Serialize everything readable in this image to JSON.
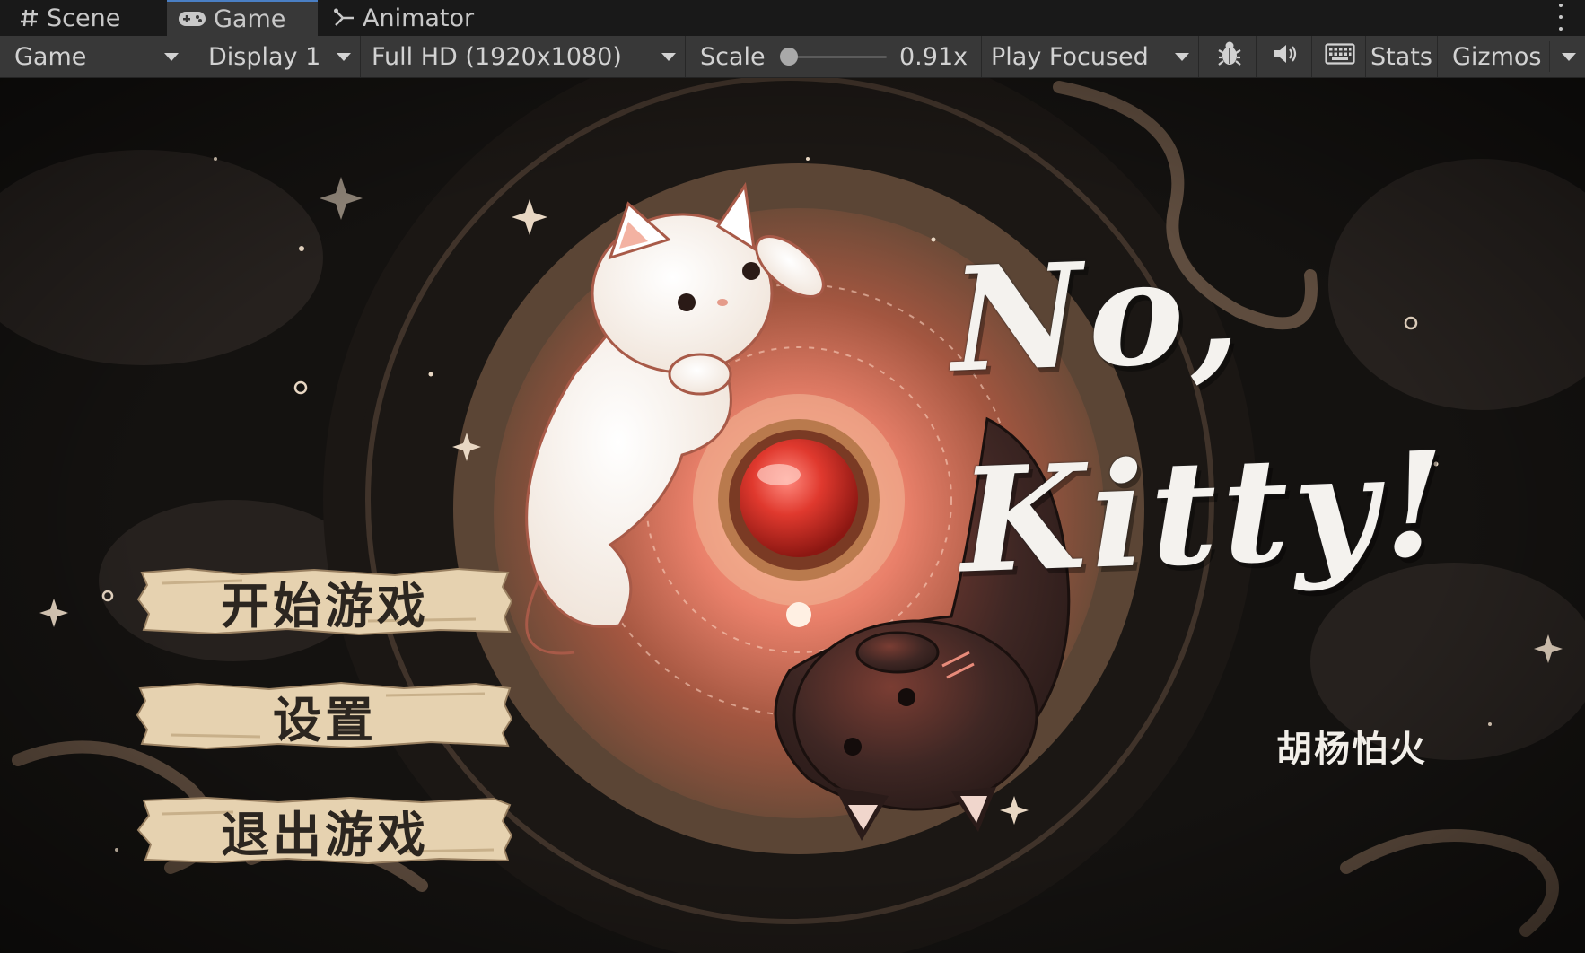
{
  "tabs": [
    {
      "label": "Scene",
      "icon": "grid-hash-icon"
    },
    {
      "label": "Game",
      "icon": "gamepad-icon",
      "active": true
    },
    {
      "label": "Animator",
      "icon": "animator-branch-icon"
    }
  ],
  "toolbar": {
    "view_mode": "Game",
    "display": "Display 1",
    "resolution": "Full HD (1920x1080)",
    "scale_label": "Scale",
    "scale_value": "0.91x",
    "play_mode": "Play Focused",
    "icons": [
      "bug-icon",
      "audio-speaker-icon",
      "keyboard-icon"
    ],
    "stats": "Stats",
    "gizmos": "Gizmos"
  },
  "game": {
    "title_line1": "No,",
    "title_line2": "Kitty!",
    "author": "胡杨怕火",
    "menu": {
      "start": "开始游戏",
      "settings": "设置",
      "quit": "退出游戏"
    }
  },
  "colors": {
    "editor_bg": "#191919",
    "toolbar_bg": "#383838",
    "active_tab_accent": "#4a7fc4",
    "scene_bg": "#121110",
    "glow": "#e9806a",
    "red_button": "#d7342b",
    "parchment": "#e6d2b0"
  }
}
